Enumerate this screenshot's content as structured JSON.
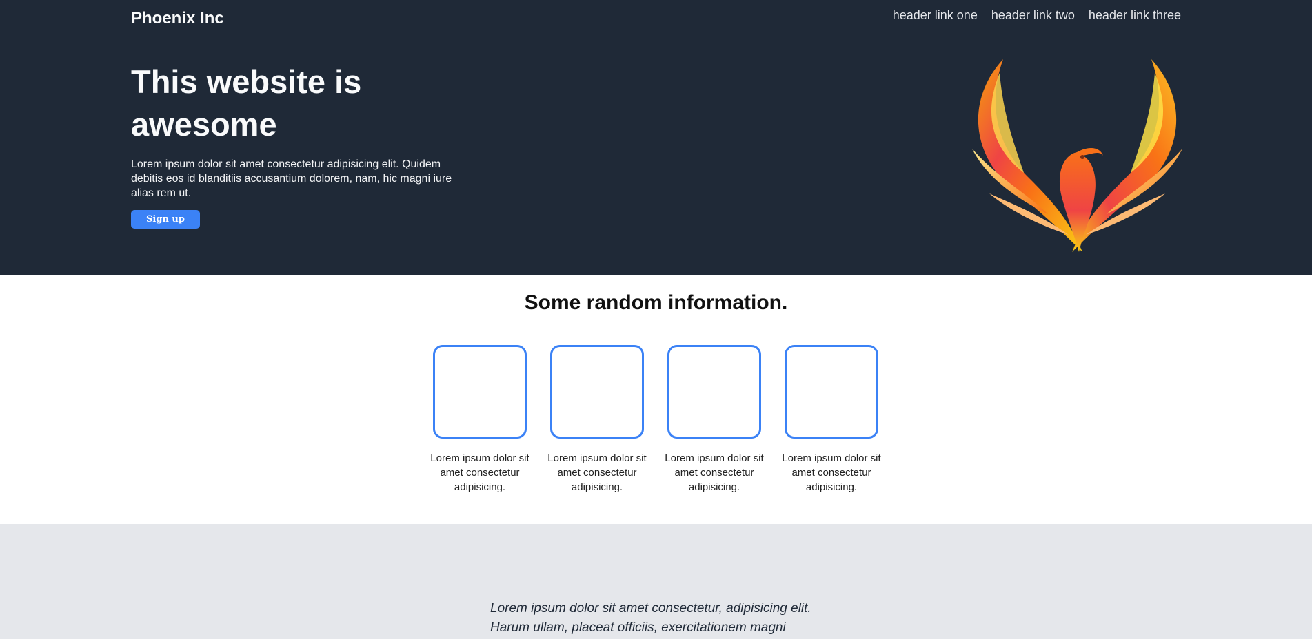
{
  "header": {
    "brand": "Phoenix Inc",
    "nav": [
      {
        "label": "header link one"
      },
      {
        "label": "header link two"
      },
      {
        "label": "header link three"
      }
    ]
  },
  "hero": {
    "title": "This website is awesome",
    "description": "Lorem ipsum dolor sit amet consectetur adipisicing elit. Quidem debitis eos id blanditiis accusantium dolorem, nam, hic magni iure alias rem ut.",
    "cta_label": "Sign up",
    "logo_icon": "phoenix-logo"
  },
  "info": {
    "title": "Some random information.",
    "cards": [
      {
        "text": "Lorem ipsum dolor sit amet consectetur adipisicing."
      },
      {
        "text": "Lorem ipsum dolor sit amet consectetur adipisicing."
      },
      {
        "text": "Lorem ipsum dolor sit amet consectetur adipisicing."
      },
      {
        "text": "Lorem ipsum dolor sit amet consectetur adipisicing."
      }
    ]
  },
  "quote": {
    "text": "Lorem ipsum dolor sit amet consectetur, adipisicing elit. Harum ullam, placeat officiis, exercitationem magni"
  },
  "colors": {
    "header_bg": "#1f2937",
    "accent": "#3b82f6",
    "quote_bg": "#e5e7eb"
  }
}
